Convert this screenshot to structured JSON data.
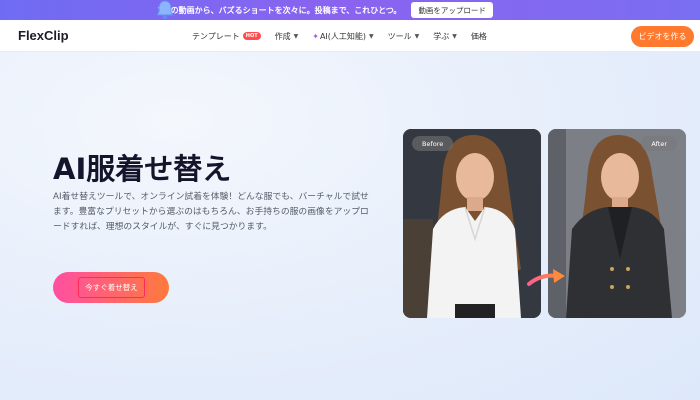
{
  "banner": {
    "text": "1本の動画から、バズるショートを次々に。投稿まで、これひとつ。",
    "button": "動画をアップロード"
  },
  "nav": {
    "logo": "FlexClip",
    "items": [
      {
        "label": "テンプレート",
        "badge": "HOT"
      },
      {
        "label": "作成"
      },
      {
        "label": "AI(人工知能)"
      },
      {
        "label": "ツール"
      },
      {
        "label": "学ぶ"
      },
      {
        "label": "価格"
      }
    ],
    "cta": "ビデオを作る"
  },
  "hero": {
    "title": "AI服着せ替え",
    "description": "AI着せ替えツールで、オンライン試着を体験！どんな服でも、バーチャルで試せます。豊富なプリセットから選ぶのはもちろん、お手持ちの服の画像をアップロードすれば、理想のスタイルが、すぐに見つかります。",
    "button": "今すぐ着せ替え",
    "before_label": "Before",
    "after_label": "After"
  },
  "colors": {
    "accent_orange": "#ff7a2f",
    "banner_purple": "#7a6ef2",
    "cta_gradient_start": "#ff4fa1"
  }
}
